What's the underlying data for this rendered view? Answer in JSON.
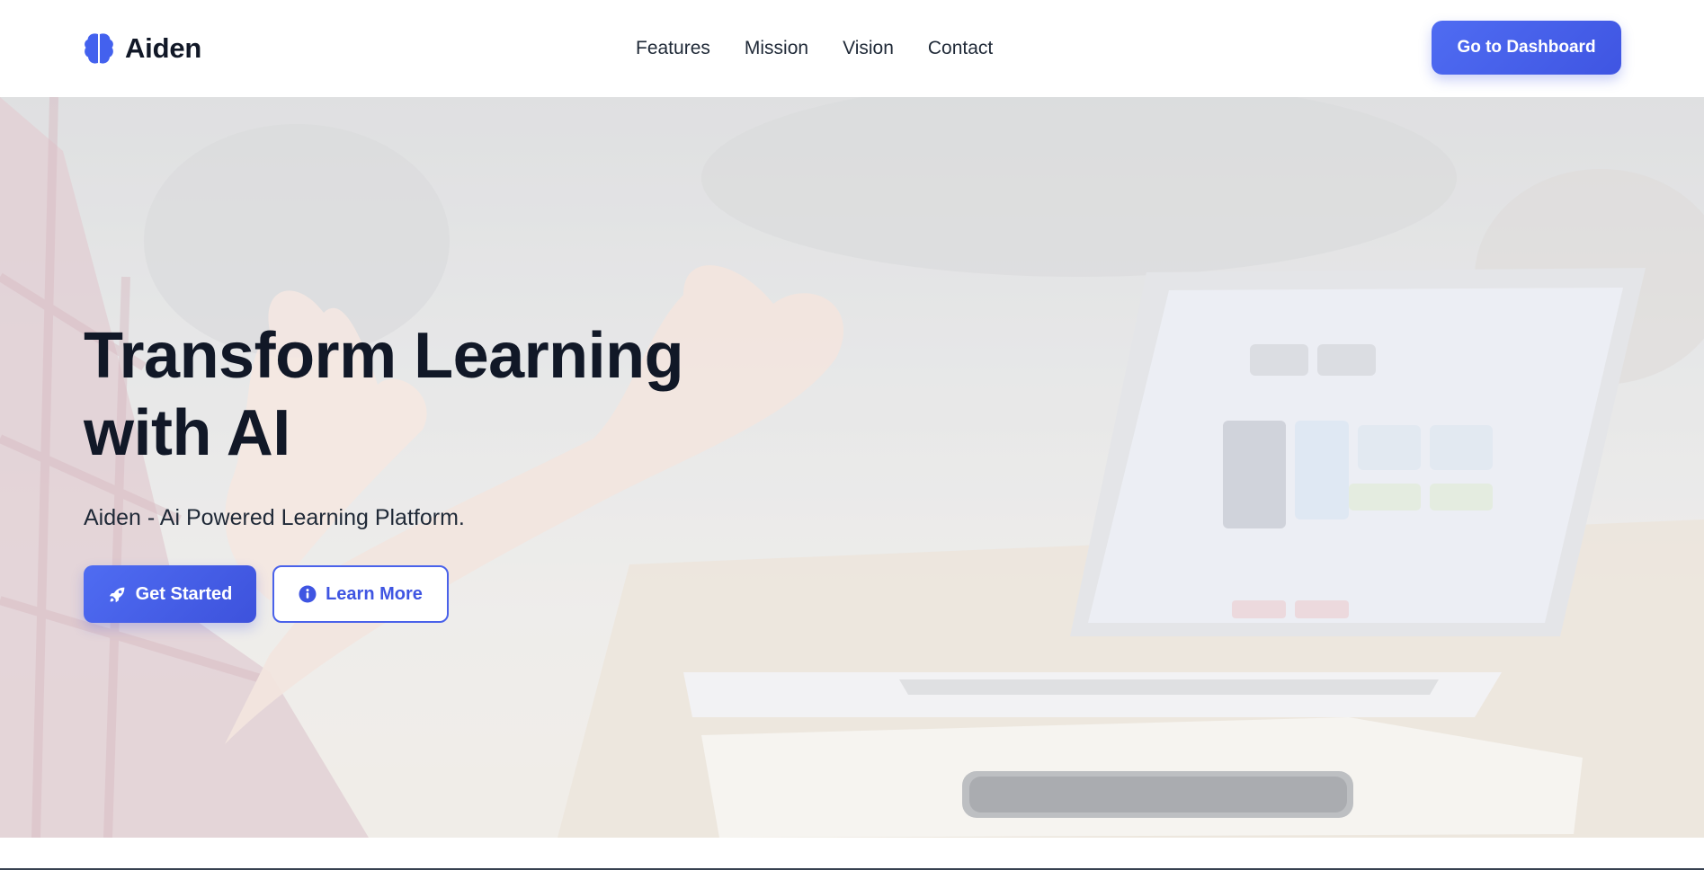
{
  "brand": {
    "name": "Aiden",
    "icon": "brain-icon",
    "accent": "#4361ee"
  },
  "nav": {
    "items": [
      {
        "label": "Features"
      },
      {
        "label": "Mission"
      },
      {
        "label": "Vision"
      },
      {
        "label": "Contact"
      }
    ]
  },
  "header": {
    "dashboard_label": "Go to Dashboard"
  },
  "hero": {
    "title_line1": "Transform Learning",
    "title_line2": "with AI",
    "subtitle": "Aiden - Ai Powered Learning Platform.",
    "primary_cta": {
      "label": "Get Started",
      "icon": "rocket-icon"
    },
    "secondary_cta": {
      "label": "Learn More",
      "icon": "info-circle-icon"
    },
    "background_image": "classroom-laptop-photo"
  }
}
